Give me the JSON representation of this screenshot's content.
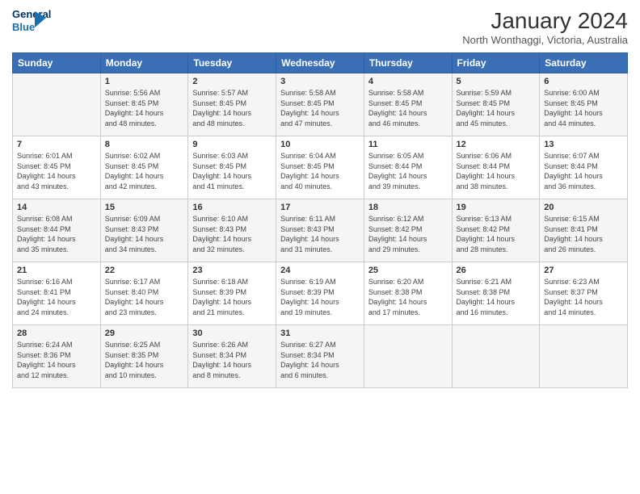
{
  "header": {
    "logo_line1": "General",
    "logo_line2": "Blue",
    "month": "January 2024",
    "location": "North Wonthaggi, Victoria, Australia"
  },
  "days_of_week": [
    "Sunday",
    "Monday",
    "Tuesday",
    "Wednesday",
    "Thursday",
    "Friday",
    "Saturday"
  ],
  "weeks": [
    [
      {
        "day": "",
        "content": ""
      },
      {
        "day": "1",
        "content": "Sunrise: 5:56 AM\nSunset: 8:45 PM\nDaylight: 14 hours\nand 48 minutes."
      },
      {
        "day": "2",
        "content": "Sunrise: 5:57 AM\nSunset: 8:45 PM\nDaylight: 14 hours\nand 48 minutes."
      },
      {
        "day": "3",
        "content": "Sunrise: 5:58 AM\nSunset: 8:45 PM\nDaylight: 14 hours\nand 47 minutes."
      },
      {
        "day": "4",
        "content": "Sunrise: 5:58 AM\nSunset: 8:45 PM\nDaylight: 14 hours\nand 46 minutes."
      },
      {
        "day": "5",
        "content": "Sunrise: 5:59 AM\nSunset: 8:45 PM\nDaylight: 14 hours\nand 45 minutes."
      },
      {
        "day": "6",
        "content": "Sunrise: 6:00 AM\nSunset: 8:45 PM\nDaylight: 14 hours\nand 44 minutes."
      }
    ],
    [
      {
        "day": "7",
        "content": "Sunrise: 6:01 AM\nSunset: 8:45 PM\nDaylight: 14 hours\nand 43 minutes."
      },
      {
        "day": "8",
        "content": "Sunrise: 6:02 AM\nSunset: 8:45 PM\nDaylight: 14 hours\nand 42 minutes."
      },
      {
        "day": "9",
        "content": "Sunrise: 6:03 AM\nSunset: 8:45 PM\nDaylight: 14 hours\nand 41 minutes."
      },
      {
        "day": "10",
        "content": "Sunrise: 6:04 AM\nSunset: 8:45 PM\nDaylight: 14 hours\nand 40 minutes."
      },
      {
        "day": "11",
        "content": "Sunrise: 6:05 AM\nSunset: 8:44 PM\nDaylight: 14 hours\nand 39 minutes."
      },
      {
        "day": "12",
        "content": "Sunrise: 6:06 AM\nSunset: 8:44 PM\nDaylight: 14 hours\nand 38 minutes."
      },
      {
        "day": "13",
        "content": "Sunrise: 6:07 AM\nSunset: 8:44 PM\nDaylight: 14 hours\nand 36 minutes."
      }
    ],
    [
      {
        "day": "14",
        "content": "Sunrise: 6:08 AM\nSunset: 8:44 PM\nDaylight: 14 hours\nand 35 minutes."
      },
      {
        "day": "15",
        "content": "Sunrise: 6:09 AM\nSunset: 8:43 PM\nDaylight: 14 hours\nand 34 minutes."
      },
      {
        "day": "16",
        "content": "Sunrise: 6:10 AM\nSunset: 8:43 PM\nDaylight: 14 hours\nand 32 minutes."
      },
      {
        "day": "17",
        "content": "Sunrise: 6:11 AM\nSunset: 8:43 PM\nDaylight: 14 hours\nand 31 minutes."
      },
      {
        "day": "18",
        "content": "Sunrise: 6:12 AM\nSunset: 8:42 PM\nDaylight: 14 hours\nand 29 minutes."
      },
      {
        "day": "19",
        "content": "Sunrise: 6:13 AM\nSunset: 8:42 PM\nDaylight: 14 hours\nand 28 minutes."
      },
      {
        "day": "20",
        "content": "Sunrise: 6:15 AM\nSunset: 8:41 PM\nDaylight: 14 hours\nand 26 minutes."
      }
    ],
    [
      {
        "day": "21",
        "content": "Sunrise: 6:16 AM\nSunset: 8:41 PM\nDaylight: 14 hours\nand 24 minutes."
      },
      {
        "day": "22",
        "content": "Sunrise: 6:17 AM\nSunset: 8:40 PM\nDaylight: 14 hours\nand 23 minutes."
      },
      {
        "day": "23",
        "content": "Sunrise: 6:18 AM\nSunset: 8:39 PM\nDaylight: 14 hours\nand 21 minutes."
      },
      {
        "day": "24",
        "content": "Sunrise: 6:19 AM\nSunset: 8:39 PM\nDaylight: 14 hours\nand 19 minutes."
      },
      {
        "day": "25",
        "content": "Sunrise: 6:20 AM\nSunset: 8:38 PM\nDaylight: 14 hours\nand 17 minutes."
      },
      {
        "day": "26",
        "content": "Sunrise: 6:21 AM\nSunset: 8:38 PM\nDaylight: 14 hours\nand 16 minutes."
      },
      {
        "day": "27",
        "content": "Sunrise: 6:23 AM\nSunset: 8:37 PM\nDaylight: 14 hours\nand 14 minutes."
      }
    ],
    [
      {
        "day": "28",
        "content": "Sunrise: 6:24 AM\nSunset: 8:36 PM\nDaylight: 14 hours\nand 12 minutes."
      },
      {
        "day": "29",
        "content": "Sunrise: 6:25 AM\nSunset: 8:35 PM\nDaylight: 14 hours\nand 10 minutes."
      },
      {
        "day": "30",
        "content": "Sunrise: 6:26 AM\nSunset: 8:34 PM\nDaylight: 14 hours\nand 8 minutes."
      },
      {
        "day": "31",
        "content": "Sunrise: 6:27 AM\nSunset: 8:34 PM\nDaylight: 14 hours\nand 6 minutes."
      },
      {
        "day": "",
        "content": ""
      },
      {
        "day": "",
        "content": ""
      },
      {
        "day": "",
        "content": ""
      }
    ]
  ]
}
